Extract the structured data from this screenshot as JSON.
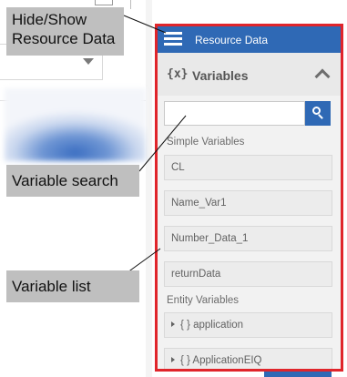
{
  "callouts": {
    "hide_show": "Hide/Show Resource Data",
    "variable_search": "Variable search",
    "variable_list": "Variable list"
  },
  "panel": {
    "header_title": "Resource Data",
    "header_icon": "hamburger-icon",
    "section_icon_text": "{x}",
    "section_title": "Variables",
    "collapse_icon": "chevron-up-icon",
    "search": {
      "value": "",
      "placeholder": "",
      "button_icon": "search-icon"
    },
    "simple_label": "Simple Variables",
    "simple_variables": [
      "CL",
      "Name_Var1",
      "Number_Data_1",
      "returnData"
    ],
    "entity_label": "Entity Variables",
    "entity_variables": [
      "{ } application",
      "{ } ApplicationEIQ"
    ]
  },
  "colors": {
    "header_blue": "#2f69b5",
    "highlight_red": "#e0252b",
    "callout_gray": "#bfbfbf"
  }
}
